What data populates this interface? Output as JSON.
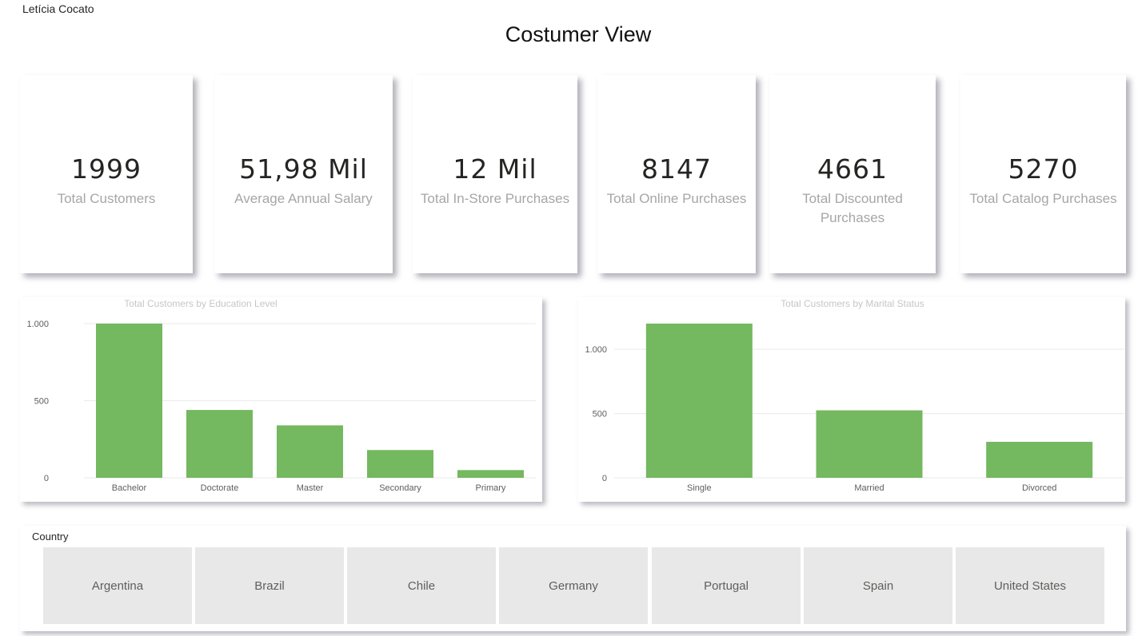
{
  "header": {
    "author": "Letícia Cocato",
    "title": "Costumer View"
  },
  "kpis": [
    {
      "value": "1999",
      "label": "Total Customers"
    },
    {
      "value": "51,98 Mil",
      "label": "Average Annual Salary"
    },
    {
      "value": "12 Mil",
      "label": "Total In-Store Purchases"
    },
    {
      "value": "8147",
      "label": "Total Online Purchases"
    },
    {
      "value": "4661",
      "label": "Total Discounted Purchases"
    },
    {
      "value": "5270",
      "label": "Total Catalog Purchases"
    }
  ],
  "chart_data": [
    {
      "type": "bar",
      "title": "Total Customers by Education Level",
      "categories": [
        "Bachelor",
        "Doctorate",
        "Master",
        "Secondary",
        "Primary"
      ],
      "values": [
        1000,
        440,
        340,
        180,
        50
      ],
      "ylim": [
        0,
        1000
      ],
      "yticks": [
        0,
        500,
        1000
      ],
      "ytick_labels": [
        "0",
        "500",
        "1.000"
      ],
      "grid": true,
      "color": "#74b85f"
    },
    {
      "type": "bar",
      "title": "Total Customers by Marital Status",
      "categories": [
        "Single",
        "Married",
        "Divorced"
      ],
      "values": [
        1200,
        525,
        280
      ],
      "ylim": [
        0,
        1200
      ],
      "yticks": [
        0,
        500,
        1000
      ],
      "ytick_labels": [
        "0",
        "500",
        "1.000"
      ],
      "grid": true,
      "color": "#74b85f"
    }
  ],
  "slicer": {
    "title": "Country",
    "options": [
      "Argentina",
      "Brazil",
      "Chile",
      "Germany",
      "Portugal",
      "Spain",
      "United States"
    ]
  },
  "colors": {
    "bar": "#74b85f",
    "button_bg": "#e8e8e8",
    "label_gray": "#a6a6a6"
  }
}
